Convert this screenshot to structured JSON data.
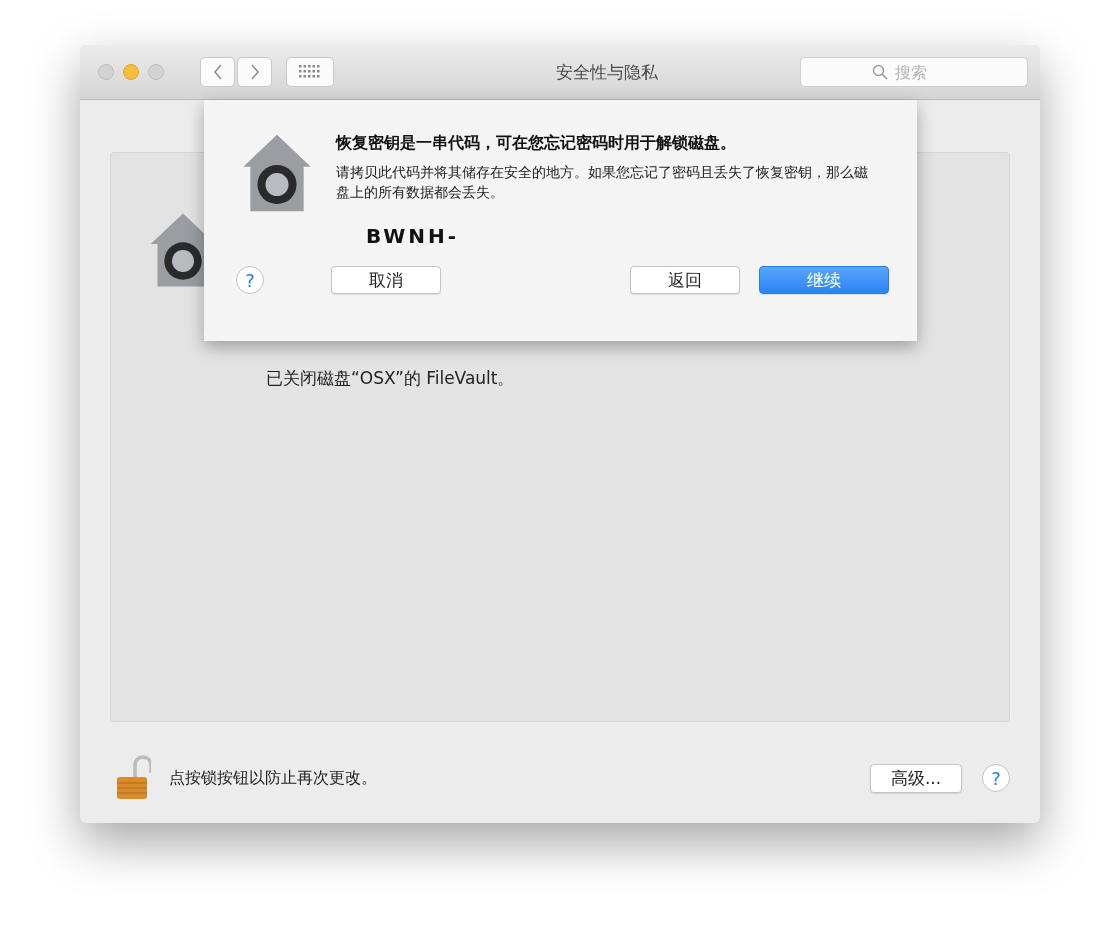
{
  "window": {
    "title": "安全性与隐私"
  },
  "search": {
    "placeholder": "搜索"
  },
  "panel": {
    "status": "已关闭磁盘“OSX”的 FileVault。"
  },
  "sheet": {
    "heading": "恢复密钥是一串代码，可在您忘记密码时用于解锁磁盘。",
    "body": "请拷贝此代码并将其储存在安全的地方。如果您忘记了密码且丢失了恢复密钥，那么磁盘上的所有数据都会丢失。",
    "recovery_key": "BWNH-",
    "help": "?",
    "buttons": [
      {
        "label": "取消",
        "kind": "default"
      },
      {
        "label": "返回",
        "kind": "default"
      },
      {
        "label": "继续",
        "kind": "primary"
      }
    ]
  },
  "footer": {
    "lock_text": "点按锁按钮以防止再次更改。",
    "locked": false,
    "advanced_button": "高级...",
    "help": "?"
  }
}
